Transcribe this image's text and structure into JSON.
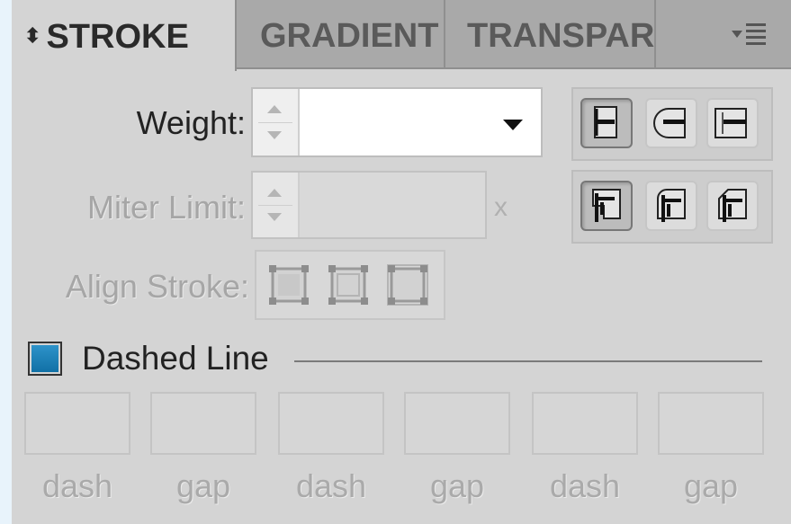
{
  "panel": {
    "tabs": [
      {
        "label": "STROKE",
        "active": true
      },
      {
        "label": "GRADIENT",
        "active": false
      },
      {
        "label": "TRANSPAR",
        "active": false
      }
    ],
    "menu_icon": "panel-menu-icon"
  },
  "weight": {
    "label": "Weight:",
    "value": ""
  },
  "miter": {
    "label": "Miter Limit:",
    "value": "",
    "suffix": "x"
  },
  "align": {
    "label": "Align Stroke:"
  },
  "cap_buttons": [
    "butt-cap-icon",
    "round-cap-icon",
    "projecting-cap-icon"
  ],
  "join_buttons": [
    "miter-join-icon",
    "round-join-icon",
    "bevel-join-icon"
  ],
  "align_buttons": [
    "align-center-icon",
    "align-inside-icon",
    "align-outside-icon"
  ],
  "dashed": {
    "label": "Dashed Line",
    "checked": true,
    "fields": [
      {
        "label": "dash",
        "value": ""
      },
      {
        "label": "gap",
        "value": ""
      },
      {
        "label": "dash",
        "value": ""
      },
      {
        "label": "gap",
        "value": ""
      },
      {
        "label": "dash",
        "value": ""
      },
      {
        "label": "gap",
        "value": ""
      }
    ]
  },
  "colors": {
    "panel_bg": "#d4d4d4",
    "checkbox_fill": "#1f82b8"
  }
}
